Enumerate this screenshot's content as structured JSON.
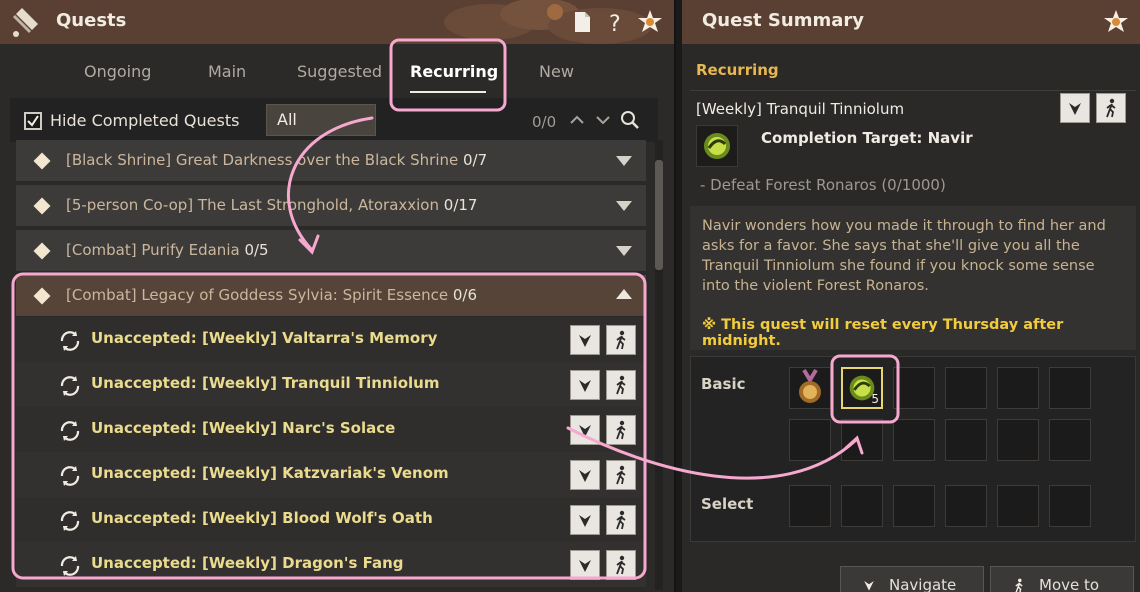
{
  "quests_window": {
    "title": "Quests",
    "icons": [
      "scroll-icon",
      "document-icon",
      "help-icon",
      "settings-emblem-icon"
    ],
    "tabs": [
      {
        "label": "Ongoing",
        "active": false
      },
      {
        "label": "Main",
        "active": false
      },
      {
        "label": "Suggested",
        "active": false
      },
      {
        "label": "Recurring",
        "active": true
      },
      {
        "label": "New",
        "active": false
      }
    ],
    "filter": {
      "hide_completed_label": "Hide Completed Quests",
      "hide_completed_checked": true,
      "dropdown_value": "All",
      "count": "0/0"
    },
    "groups": [
      {
        "title": "[Black Shrine] Great Darkness over the Black Shrine",
        "count": "0/7",
        "expanded": false
      },
      {
        "title": "[5-person Co-op] The Last Stronghold, Atoraxxion",
        "count": "0/17",
        "expanded": false
      },
      {
        "title": "[Combat] Purify Edania",
        "count": "0/5",
        "expanded": false
      },
      {
        "title": "[Combat] Legacy of Goddess Sylvia: Spirit Essence",
        "count": "0/6",
        "expanded": true
      }
    ],
    "sub_quests": [
      "Unaccepted: [Weekly] Valtarra's Memory",
      "Unaccepted: [Weekly] Tranquil Tinniolum",
      "Unaccepted: [Weekly] Narc's Solace",
      "Unaccepted: [Weekly] Katzvariak's Venom",
      "Unaccepted: [Weekly] Blood Wolf's Oath",
      "Unaccepted: [Weekly] Dragon's Fang"
    ]
  },
  "summary_window": {
    "title": "Quest Summary",
    "category": "Recurring",
    "quest_name": "[Weekly] Tranquil Tinniolum",
    "completion_target": "Completion Target: Navir",
    "objective": "- Defeat Forest Ronaros (0/1000)",
    "description": "Navir wonders how you made it through to find her and asks for a favor. She says that she'll give you all the Tranquil Tinniolum she found if you knock some sense into the violent Forest Ronaros.",
    "reset_note": "※ This quest will reset every Thursday after midnight.",
    "rewards": {
      "basic_label": "Basic",
      "select_label": "Select",
      "basic_items": [
        {
          "icon": "medal-icon",
          "qty": ""
        },
        {
          "icon": "tinniolum-icon",
          "qty": "5"
        }
      ]
    },
    "buttons": {
      "navigate": "Navigate",
      "move_to": "Move to"
    }
  },
  "colors": {
    "title_bar": "#5a4032",
    "sub_quest_text": "#eadb8e",
    "category_text": "#e8b84f",
    "reset_text": "#f2cc3d",
    "annotation_pink": "#f7a8cf"
  }
}
